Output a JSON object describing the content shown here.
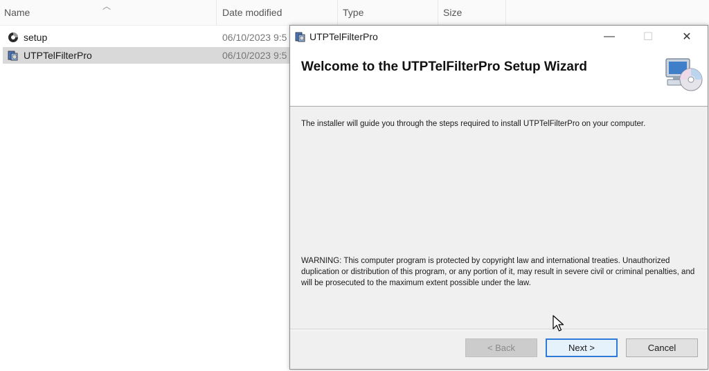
{
  "explorer": {
    "columns": {
      "name": "Name",
      "date_modified": "Date modified",
      "type": "Type",
      "size": "Size"
    },
    "files": [
      {
        "name": "setup",
        "date": "06/10/2023 9:5",
        "icon": "setup-icon"
      },
      {
        "name": "UTPTelFilterPro",
        "date": "06/10/2023 9:5",
        "icon": "installer-package-icon",
        "selected": true
      }
    ]
  },
  "dialog": {
    "title": "UTPTelFilterPro",
    "heading": "Welcome to the UTPTelFilterPro Setup Wizard",
    "intro": "The installer will guide you through the steps required to install UTPTelFilterPro on your computer.",
    "warning": "WARNING: This computer program is protected by copyright law and international treaties. Unauthorized duplication or distribution of this program, or any portion of it, may result in severe civil or criminal penalties, and will be prosecuted to the maximum extent possible under the law.",
    "buttons": {
      "back": "< Back",
      "next": "Next >",
      "cancel": "Cancel"
    },
    "window_controls": {
      "minimize": "—",
      "maximize": "☐",
      "close": "✕"
    }
  },
  "colors": {
    "default_button_border": "#2d7bd6",
    "selected_row": "#d9d9d9"
  }
}
